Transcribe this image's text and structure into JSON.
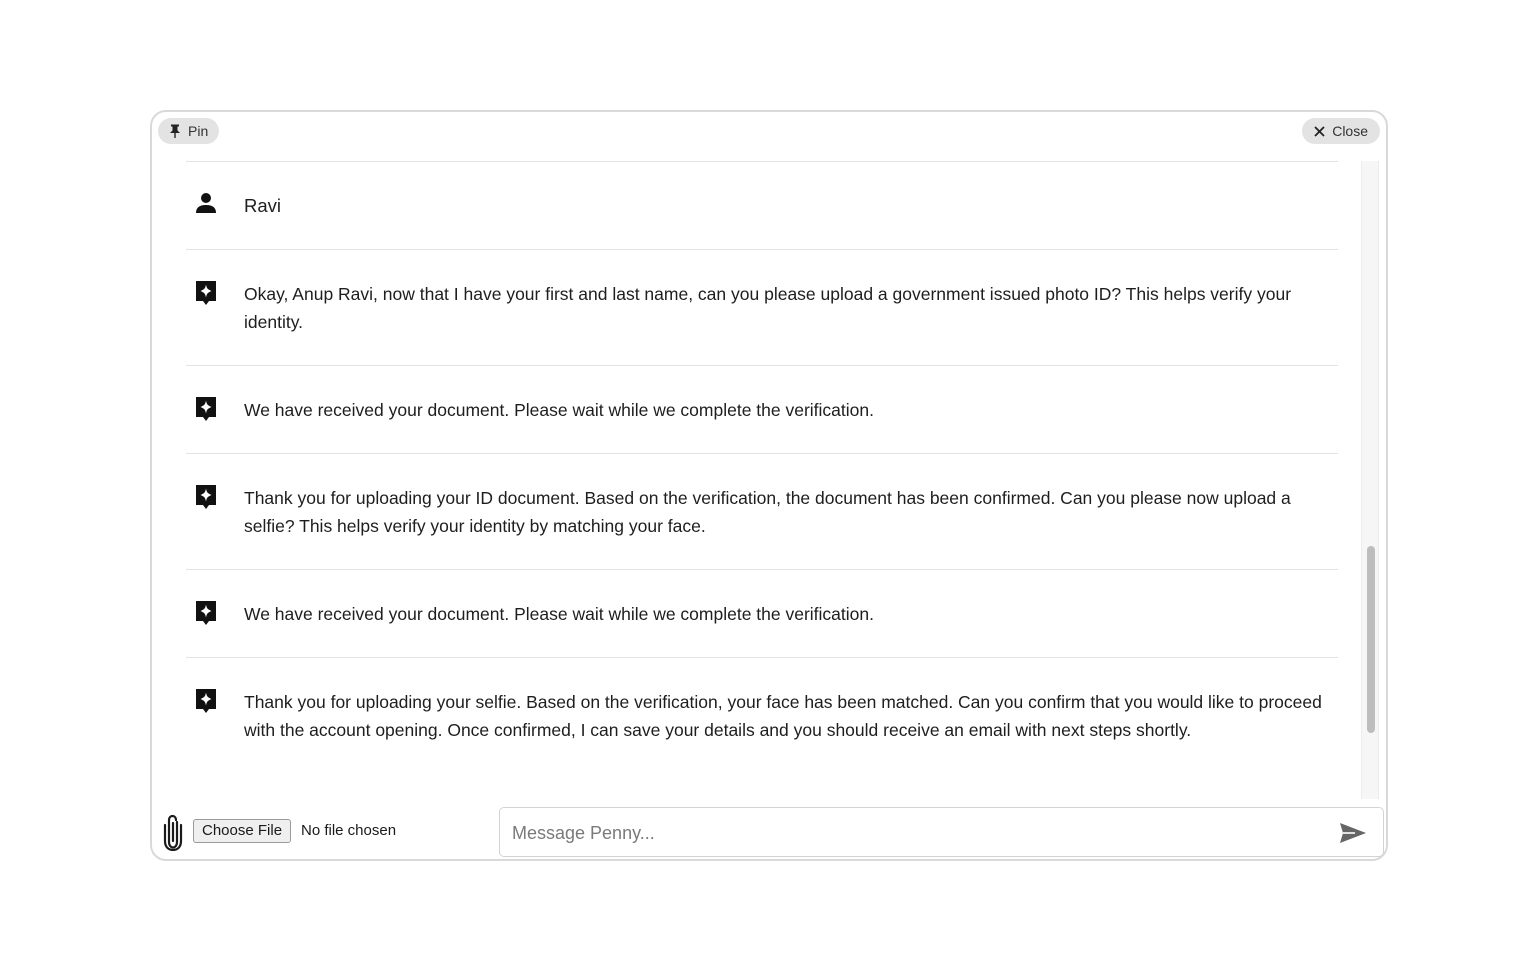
{
  "header": {
    "pin_label": "Pin",
    "close_label": "Close",
    "pin_icon": "pushpin-icon",
    "close_icon": "x-icon"
  },
  "messages": [
    {
      "sender": "user",
      "icon": "person-icon",
      "text": "Ravi"
    },
    {
      "sender": "assistant",
      "icon": "sparkle-chat-icon",
      "text": "Okay, Anup Ravi, now that I have your first and last name, can you please upload a government issued photo ID? This helps verify your identity."
    },
    {
      "sender": "assistant",
      "icon": "sparkle-chat-icon",
      "text": "We have received your document. Please wait while we complete the verification."
    },
    {
      "sender": "assistant",
      "icon": "sparkle-chat-icon",
      "text": "Thank you for uploading your ID document. Based on the verification, the document has been confirmed. Can you please now upload a selfie? This helps verify your identity by matching your face."
    },
    {
      "sender": "assistant",
      "icon": "sparkle-chat-icon",
      "text": "We have received your document. Please wait while we complete the verification."
    },
    {
      "sender": "assistant",
      "icon": "sparkle-chat-icon",
      "text": "Thank you for uploading your selfie. Based on the verification, your face has been matched. Can you confirm that you would like to proceed with the account opening. Once confirmed, I can save your details and you should receive an email with next steps shortly."
    }
  ],
  "composer": {
    "attach_icon": "paperclip-icon",
    "choose_file_label": "Choose File",
    "file_status": "No file chosen",
    "message_value": "",
    "message_placeholder": "Message Penny...",
    "send_icon": "send-icon"
  },
  "colors": {
    "icon": "#111111",
    "pill_bg": "#e3e3e3",
    "border": "#d9d9d9",
    "scroll_thumb": "#bdbdbd",
    "send_icon": "#666666"
  }
}
